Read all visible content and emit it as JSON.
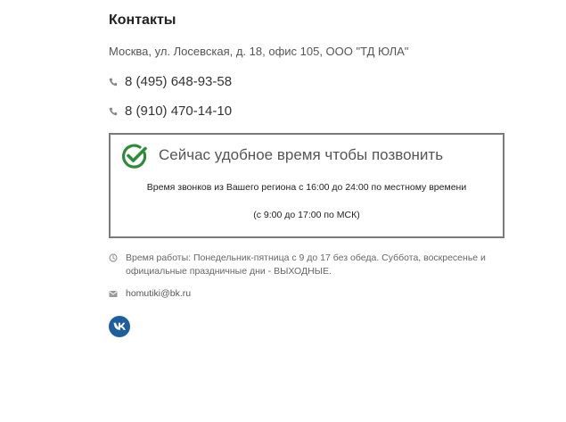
{
  "contacts": {
    "title": "Контакты",
    "address": "Москва, ул. Лосевская, д. 18, офис 105, ООО \"ТД ЮЛА\"",
    "phones": [
      {
        "icon": "phone-icon",
        "number": "8 (495) 648-93-58"
      },
      {
        "icon": "phone-icon",
        "number": "8 (910) 470-14-10"
      }
    ],
    "callbox": {
      "icon": "check-circle-icon",
      "headline": "Сейчас удобное время чтобы позвонить",
      "regional_hours": "Время звонков из Вашего региона с 16:00 до 24:00 по местному времени",
      "msk_hours": "(с 9:00 до 17:00 по МСК)"
    },
    "work_hours": {
      "icon": "clock-icon",
      "text": "Время работы: Понедельник-пятница с 9 до 17 без обеда. Суббота, воскресенье и официальные праздничные дни - ВЫХОДНЫЕ."
    },
    "email": {
      "icon": "envelope-icon",
      "address": "homutiki@bk.ru"
    },
    "social": {
      "icon": "vk-icon"
    }
  },
  "colors": {
    "accent_green": "#2e8b3a",
    "vk_blue": "#1d5f9e",
    "box_border": "#7a7a7a"
  }
}
